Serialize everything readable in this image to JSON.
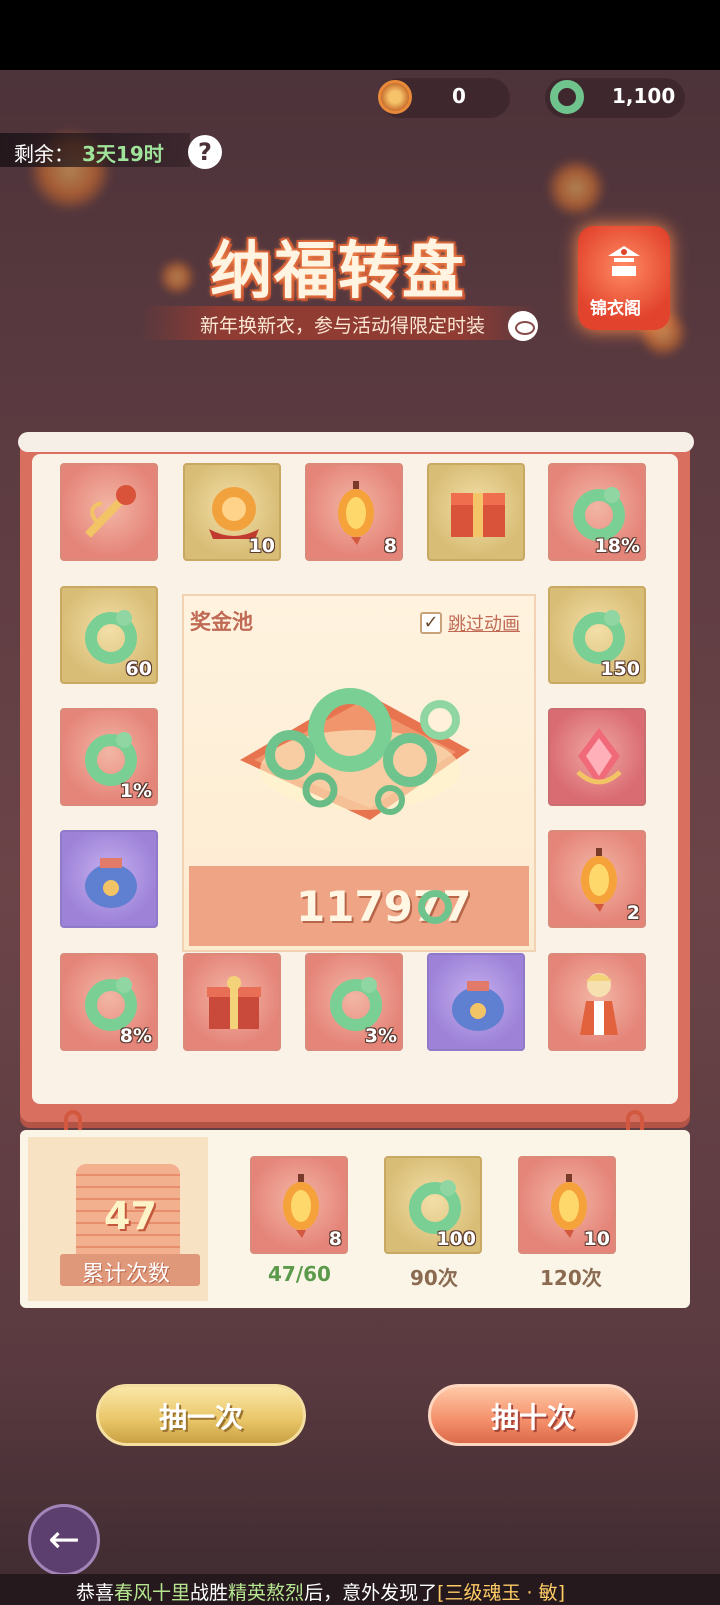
{
  "currencies": {
    "coin": "0",
    "jade": "1,100"
  },
  "timer": {
    "label": "剩余：",
    "value": "3天19时"
  },
  "header": {
    "title": "纳福转盘",
    "subtitle": "新年换新衣，参与活动得限定时装"
  },
  "wardrobe_label": "锦衣阁",
  "pool": {
    "label": "奖金池",
    "skip_label": "跳过动画",
    "skip_checked": true,
    "value": "117977"
  },
  "board_items": [
    {
      "kind": "weapon",
      "bg": "red",
      "qty": ""
    },
    {
      "kind": "orb",
      "bg": "gold",
      "qty": "10"
    },
    {
      "kind": "lantern",
      "bg": "red",
      "qty": "8"
    },
    {
      "kind": "chest",
      "bg": "gold",
      "qty": ""
    },
    {
      "kind": "jade",
      "bg": "red",
      "qty": "18%"
    },
    {
      "kind": "jade",
      "bg": "gold",
      "qty": "60"
    },
    {
      "kind": "jade",
      "bg": "gold",
      "qty": "150"
    },
    {
      "kind": "jade",
      "bg": "red",
      "qty": "1%"
    },
    {
      "kind": "crystal",
      "bg": "pink",
      "qty": ""
    },
    {
      "kind": "bag",
      "bg": "purple",
      "qty": ""
    },
    {
      "kind": "lantern",
      "bg": "red",
      "qty": "2"
    },
    {
      "kind": "jade",
      "bg": "red",
      "qty": "8%"
    },
    {
      "kind": "gift",
      "bg": "red",
      "qty": ""
    },
    {
      "kind": "jade",
      "bg": "red",
      "qty": "3%"
    },
    {
      "kind": "bag",
      "bg": "purple",
      "qty": ""
    },
    {
      "kind": "character",
      "bg": "red",
      "qty": ""
    }
  ],
  "counter": {
    "value": "47",
    "label": "累计次数"
  },
  "milestones": [
    {
      "kind": "lantern",
      "bg": "red",
      "qty": "8",
      "label": "47/60",
      "color": "#5a9a4a"
    },
    {
      "kind": "jade",
      "bg": "gold",
      "qty": "100",
      "label": "90次",
      "color": "#8a6a50"
    },
    {
      "kind": "lantern",
      "bg": "red",
      "qty": "10",
      "label": "120次",
      "color": "#8a6a50"
    }
  ],
  "buttons": {
    "draw_one": "抽一次",
    "draw_ten": "抽十次"
  },
  "ticker": {
    "p1": "恭喜",
    "p2": "春风十里",
    "p3": "战胜",
    "p4": "精英熬烈",
    "p5": "后，意外发现了",
    "p6": "[三级魂玉 · 敏]"
  }
}
